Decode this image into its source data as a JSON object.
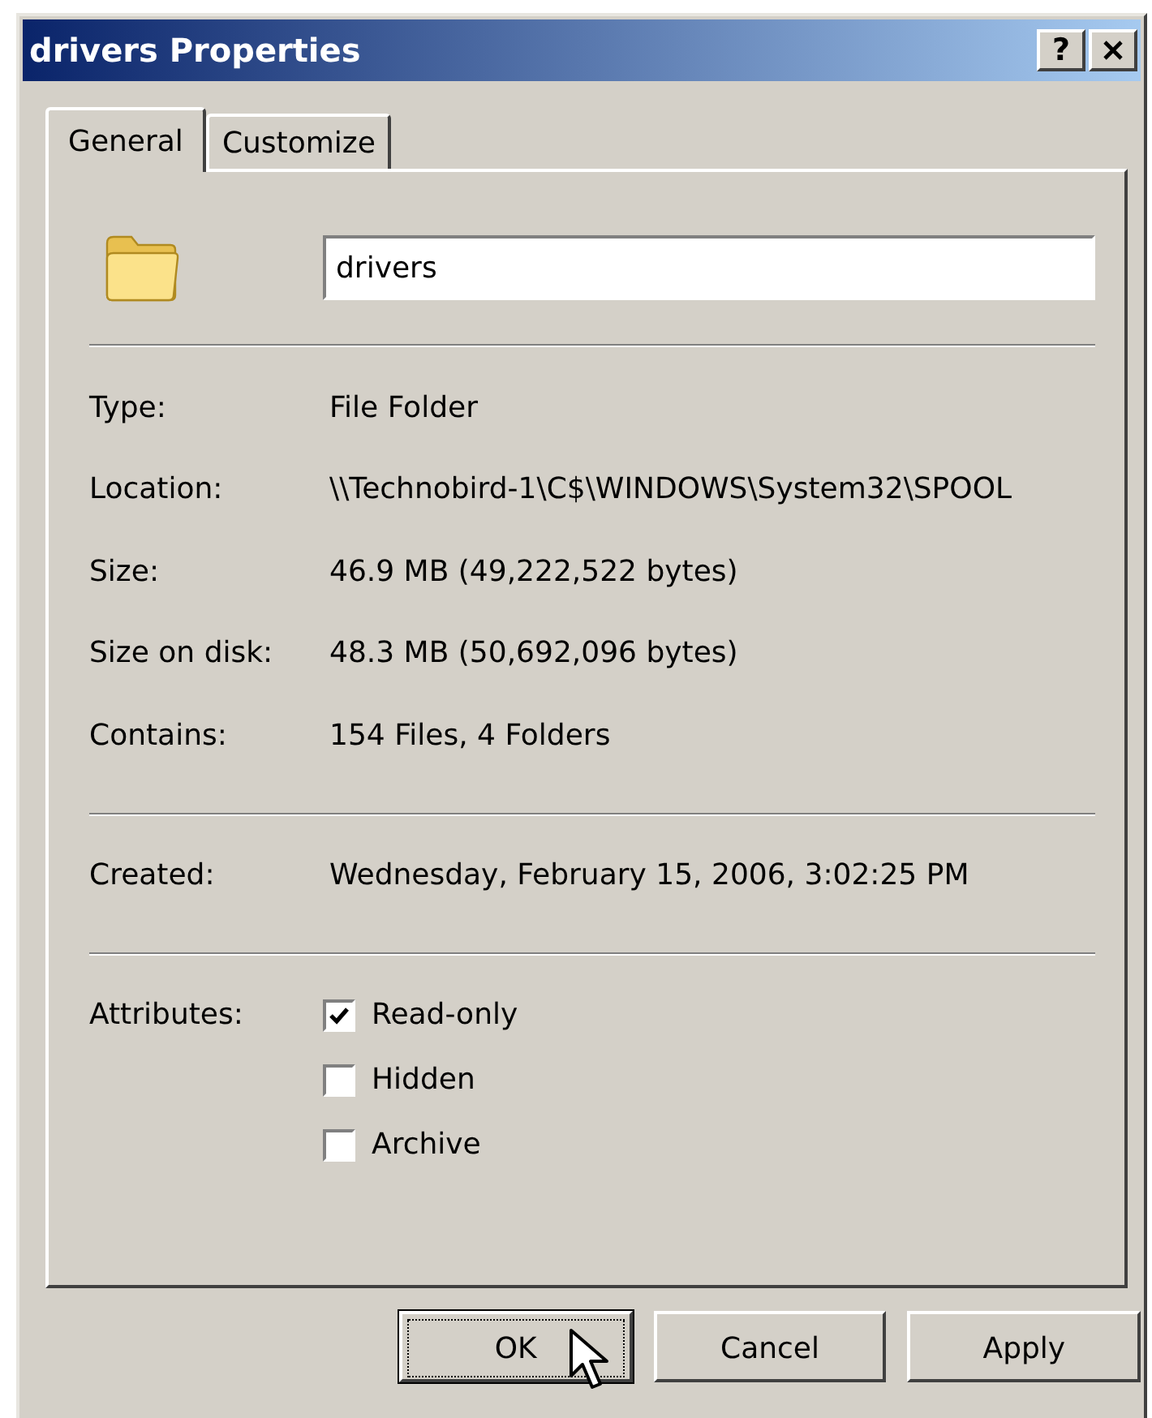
{
  "window": {
    "title": "drivers Properties",
    "help_button": "?"
  },
  "tabs": [
    {
      "label": "General",
      "selected": true
    },
    {
      "label": "Customize",
      "selected": false
    }
  ],
  "name_field": {
    "value": "drivers"
  },
  "sections": [
    [
      {
        "label": "Type:",
        "value": "File Folder"
      },
      {
        "label": "Location:",
        "value": "\\\\Technobird-1\\C$\\WINDOWS\\System32\\SPOOL"
      },
      {
        "label": "Size:",
        "value": "46.9 MB (49,222,522 bytes)"
      },
      {
        "label": "Size on disk:",
        "value": "48.3 MB (50,692,096 bytes)"
      },
      {
        "label": "Contains:",
        "value": "154 Files, 4 Folders"
      }
    ],
    [
      {
        "label": "Created:",
        "value": "Wednesday, February 15, 2006, 3:02:25 PM"
      }
    ]
  ],
  "attributes": {
    "label": "Attributes:",
    "options": [
      {
        "label": "Read-only",
        "checked": true
      },
      {
        "label": "Hidden",
        "checked": false
      },
      {
        "label": "Archive",
        "checked": false
      }
    ]
  },
  "buttons": [
    {
      "label": "OK",
      "focused": true
    },
    {
      "label": "Cancel",
      "focused": false
    },
    {
      "label": "Apply",
      "focused": false
    }
  ]
}
